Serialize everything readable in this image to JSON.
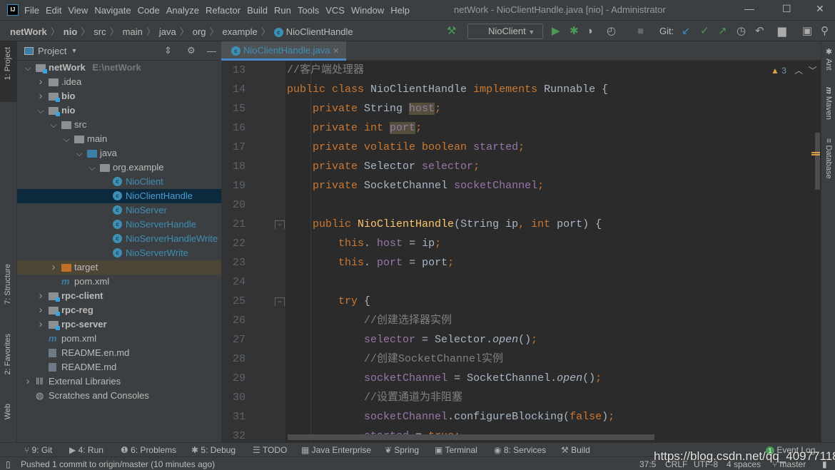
{
  "title_bar": {
    "menu": [
      "File",
      "Edit",
      "View",
      "Navigate",
      "Code",
      "Analyze",
      "Refactor",
      "Build",
      "Run",
      "Tools",
      "VCS",
      "Window",
      "Help"
    ],
    "window_title": "netWork - NioClientHandle.java [nio] - Administrator"
  },
  "breadcrumb": [
    "netWork",
    "nio",
    "src",
    "main",
    "java",
    "org",
    "example",
    "NioClientHandle"
  ],
  "toolbar": {
    "run_config": "NioClient",
    "git_label": "Git:"
  },
  "left_stripe": {
    "project": "1: Project",
    "structure": "7: Structure",
    "favorites": "2: Favorites",
    "web": "Web"
  },
  "right_stripe": {
    "ant": "Ant",
    "maven": "Maven",
    "database": "Database"
  },
  "project_panel": {
    "title": "Project",
    "tree": [
      {
        "label": "netWork",
        "extra": "E:\\netWork",
        "depth": 0,
        "chev": "down",
        "icon": "module",
        "bold": true
      },
      {
        "label": ".idea",
        "depth": 1,
        "chev": "right",
        "icon": "folder"
      },
      {
        "label": "bio",
        "depth": 1,
        "chev": "right",
        "icon": "module",
        "bold": true
      },
      {
        "label": "nio",
        "depth": 1,
        "chev": "down",
        "icon": "module",
        "bold": true
      },
      {
        "label": "src",
        "depth": 2,
        "chev": "down",
        "icon": "folder"
      },
      {
        "label": "main",
        "depth": 3,
        "chev": "down",
        "icon": "folder"
      },
      {
        "label": "java",
        "depth": 4,
        "chev": "down",
        "icon": "source-folder"
      },
      {
        "label": "org.example",
        "depth": 5,
        "chev": "down",
        "icon": "package"
      },
      {
        "label": "NioClient",
        "depth": 6,
        "icon": "class-runnable"
      },
      {
        "label": "NioClientHandle",
        "depth": 6,
        "icon": "class",
        "selected": true
      },
      {
        "label": "NioServer",
        "depth": 6,
        "icon": "class-runnable"
      },
      {
        "label": "NioServerHandle",
        "depth": 6,
        "icon": "class"
      },
      {
        "label": "NioServerHandleWrite",
        "depth": 6,
        "icon": "class"
      },
      {
        "label": "NioServerWrite",
        "depth": 6,
        "icon": "class"
      },
      {
        "label": "target",
        "depth": 2,
        "chev": "right",
        "icon": "excluded-folder",
        "highlight": true
      },
      {
        "label": "pom.xml",
        "depth": 2,
        "icon": "maven"
      },
      {
        "label": "rpc-client",
        "depth": 1,
        "chev": "right",
        "icon": "module",
        "bold": true
      },
      {
        "label": "rpc-reg",
        "depth": 1,
        "chev": "right",
        "icon": "module",
        "bold": true
      },
      {
        "label": "rpc-server",
        "depth": 1,
        "chev": "right",
        "icon": "module",
        "bold": true
      },
      {
        "label": "pom.xml",
        "depth": 1,
        "icon": "maven"
      },
      {
        "label": "README.en.md",
        "depth": 1,
        "icon": "markdown"
      },
      {
        "label": "README.md",
        "depth": 1,
        "icon": "markdown"
      },
      {
        "label": "External Libraries",
        "depth": 0,
        "chev": "right",
        "icon": "libraries"
      },
      {
        "label": "Scratches and Consoles",
        "depth": 0,
        "icon": "scratches"
      }
    ]
  },
  "editor": {
    "tab": "NioClientHandle.java",
    "warnings": "3",
    "lines": [
      {
        "n": "13",
        "t": [
          [
            "cm",
            "//客户端处理器"
          ]
        ]
      },
      {
        "n": "14",
        "t": [
          [
            "kw",
            "public class "
          ],
          [
            "",
            "NioClientHandle "
          ],
          [
            "kw",
            "implements "
          ],
          [
            "",
            "Runnable {"
          ]
        ]
      },
      {
        "n": "15",
        "t": [
          [
            "",
            "    "
          ],
          [
            "kw",
            "private "
          ],
          [
            "",
            "String "
          ],
          [
            "fd hlw",
            "host"
          ],
          [
            "kw",
            ";"
          ]
        ]
      },
      {
        "n": "16",
        "t": [
          [
            "",
            "    "
          ],
          [
            "kw",
            "private int "
          ],
          [
            "fd hlw",
            "port"
          ],
          [
            "kw",
            ";"
          ]
        ]
      },
      {
        "n": "17",
        "t": [
          [
            "",
            "    "
          ],
          [
            "kw",
            "private volatile boolean "
          ],
          [
            "fd",
            "started"
          ],
          [
            "kw",
            ";"
          ]
        ]
      },
      {
        "n": "18",
        "t": [
          [
            "",
            "    "
          ],
          [
            "kw",
            "private "
          ],
          [
            "",
            "Selector "
          ],
          [
            "fd",
            "selector"
          ],
          [
            "kw",
            ";"
          ]
        ]
      },
      {
        "n": "19",
        "t": [
          [
            "",
            "    "
          ],
          [
            "kw",
            "private "
          ],
          [
            "",
            "SocketChannel "
          ],
          [
            "fd",
            "socketChannel"
          ],
          [
            "kw",
            ";"
          ]
        ]
      },
      {
        "n": "20",
        "t": []
      },
      {
        "n": "21",
        "t": [
          [
            "",
            "    "
          ],
          [
            "kw",
            "public "
          ],
          [
            "md",
            "NioClientHandle"
          ],
          [
            "",
            "(String ip"
          ],
          [
            "kw",
            ", int "
          ],
          [
            "",
            "port) {"
          ]
        ]
      },
      {
        "n": "22",
        "t": [
          [
            "",
            "        "
          ],
          [
            "kw",
            "this"
          ],
          [
            "",
            ". "
          ],
          [
            "fd",
            "host"
          ],
          [
            "",
            " = ip"
          ],
          [
            "kw",
            ";"
          ]
        ]
      },
      {
        "n": "23",
        "t": [
          [
            "",
            "        "
          ],
          [
            "kw",
            "this"
          ],
          [
            "",
            ". "
          ],
          [
            "fd",
            "port"
          ],
          [
            "",
            " = port"
          ],
          [
            "kw",
            ";"
          ]
        ]
      },
      {
        "n": "24",
        "t": []
      },
      {
        "n": "25",
        "t": [
          [
            "",
            "        "
          ],
          [
            "kw",
            "try "
          ],
          [
            "",
            "{"
          ]
        ]
      },
      {
        "n": "26",
        "t": [
          [
            "",
            "            "
          ],
          [
            "cm",
            "//创建选择器实例"
          ]
        ]
      },
      {
        "n": "27",
        "t": [
          [
            "",
            "            "
          ],
          [
            "fd",
            "selector"
          ],
          [
            "",
            " = Selector."
          ],
          [
            "it",
            "open"
          ],
          [
            "",
            "()"
          ],
          [
            "kw",
            ";"
          ]
        ]
      },
      {
        "n": "28",
        "t": [
          [
            "",
            "            "
          ],
          [
            "cm",
            "//创建SocketChannel实例"
          ]
        ]
      },
      {
        "n": "29",
        "t": [
          [
            "",
            "            "
          ],
          [
            "fd",
            "socketChannel"
          ],
          [
            "",
            " = SocketChannel."
          ],
          [
            "it",
            "open"
          ],
          [
            "",
            "()"
          ],
          [
            "kw",
            ";"
          ]
        ]
      },
      {
        "n": "30",
        "t": [
          [
            "",
            "            "
          ],
          [
            "cm",
            "//设置通道为非阻塞"
          ]
        ]
      },
      {
        "n": "31",
        "t": [
          [
            "",
            "            "
          ],
          [
            "fd",
            "socketChannel"
          ],
          [
            "",
            ".configureBlocking("
          ],
          [
            "kw",
            "false"
          ],
          [
            "",
            ")"
          ],
          [
            "kw",
            ";"
          ]
        ]
      },
      {
        "n": "32",
        "t": [
          [
            "",
            "            "
          ],
          [
            "fd",
            "started"
          ],
          [
            "",
            " = "
          ],
          [
            "kw",
            "true;"
          ]
        ]
      }
    ]
  },
  "bottom_tools": [
    "9: Git",
    "4: Run",
    "6: Problems",
    "5: Debug",
    "TODO",
    "Java Enterprise",
    "Spring",
    "Terminal",
    "8: Services",
    "Build"
  ],
  "event_log": {
    "label": "Event Log",
    "count": "1"
  },
  "status_bar": {
    "message": "Pushed 1 commit to origin/master (10 minutes ago)",
    "position": "37:5",
    "line_sep": "CRLF",
    "encoding": "UTF-8",
    "indent": "4 spaces",
    "branch": "master"
  },
  "watermark": "https://blog.csdn.net/qq_40977118"
}
